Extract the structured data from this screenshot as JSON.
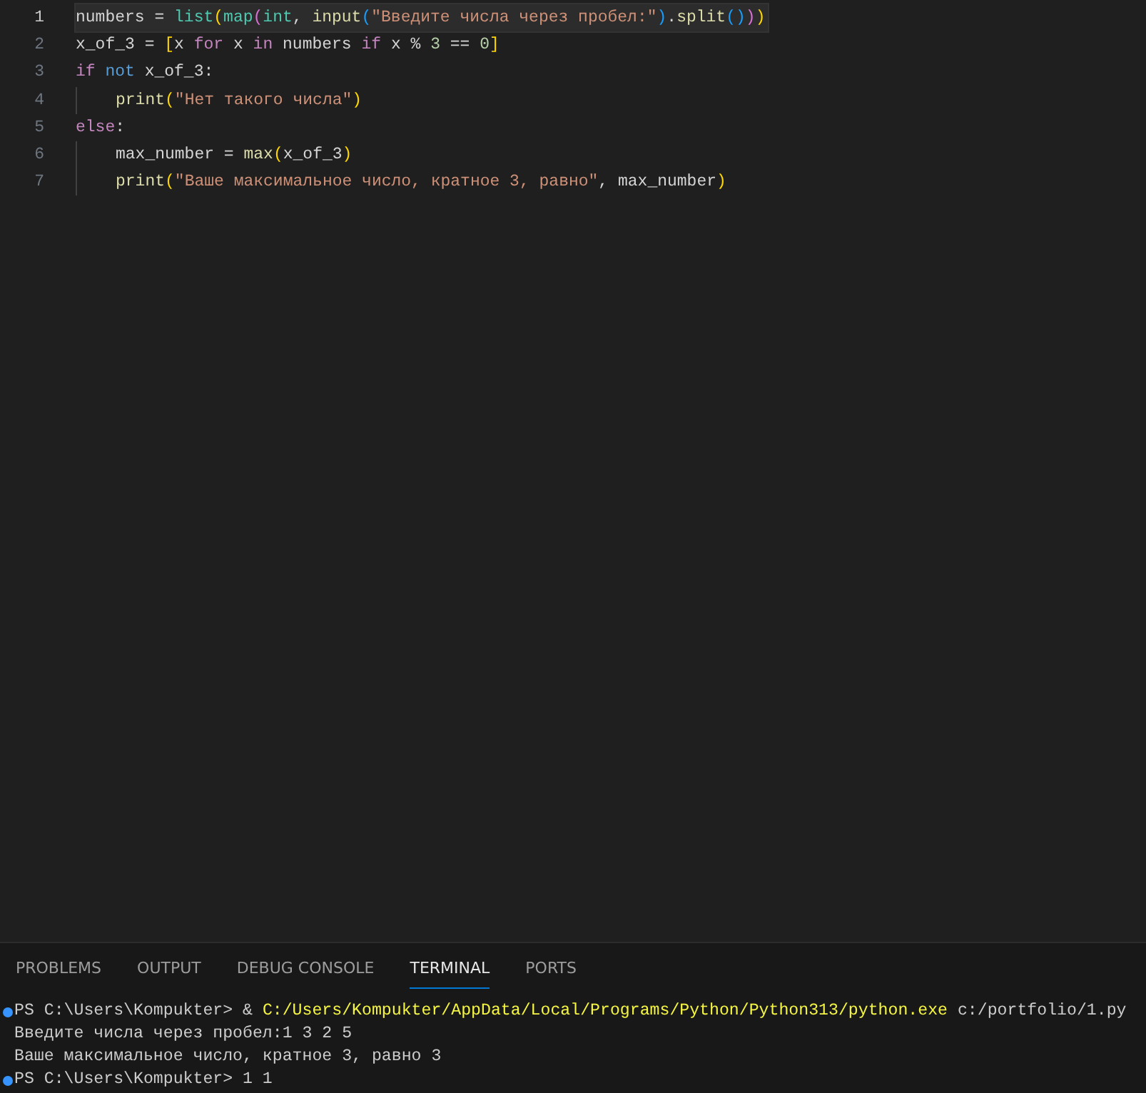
{
  "editor": {
    "lines": [
      {
        "number": "1",
        "current": true,
        "indented": false,
        "tokens": [
          {
            "kind": "var",
            "text": "numbers"
          },
          {
            "kind": "op",
            "text": " = "
          },
          {
            "kind": "cls",
            "text": "list"
          },
          {
            "kind": "b1",
            "text": "("
          },
          {
            "kind": "cls",
            "text": "map"
          },
          {
            "kind": "b2",
            "text": "("
          },
          {
            "kind": "cls",
            "text": "int"
          },
          {
            "kind": "op",
            "text": ", "
          },
          {
            "kind": "fn",
            "text": "input"
          },
          {
            "kind": "b3",
            "text": "("
          },
          {
            "kind": "str",
            "text": "\"Введите числа через пробел:\""
          },
          {
            "kind": "b3",
            "text": ")"
          },
          {
            "kind": "op",
            "text": "."
          },
          {
            "kind": "fn",
            "text": "split"
          },
          {
            "kind": "b3",
            "text": "()"
          },
          {
            "kind": "b2",
            "text": ")"
          },
          {
            "kind": "b1",
            "text": ")"
          }
        ]
      },
      {
        "number": "2",
        "current": false,
        "indented": false,
        "tokens": [
          {
            "kind": "var",
            "text": "x_of_3"
          },
          {
            "kind": "op",
            "text": " = "
          },
          {
            "kind": "b1",
            "text": "["
          },
          {
            "kind": "var",
            "text": "x "
          },
          {
            "kind": "kw",
            "text": "for"
          },
          {
            "kind": "var",
            "text": " x "
          },
          {
            "kind": "kw",
            "text": "in"
          },
          {
            "kind": "var",
            "text": " numbers "
          },
          {
            "kind": "kw",
            "text": "if"
          },
          {
            "kind": "var",
            "text": " x "
          },
          {
            "kind": "op",
            "text": "% "
          },
          {
            "kind": "num",
            "text": "3"
          },
          {
            "kind": "op",
            "text": " == "
          },
          {
            "kind": "num",
            "text": "0"
          },
          {
            "kind": "b1",
            "text": "]"
          }
        ]
      },
      {
        "number": "3",
        "current": false,
        "indented": false,
        "tokens": [
          {
            "kind": "kw",
            "text": "if"
          },
          {
            "kind": "kw2",
            "text": " not"
          },
          {
            "kind": "var",
            "text": " x_of_3"
          },
          {
            "kind": "op",
            "text": ":"
          }
        ]
      },
      {
        "number": "4",
        "current": false,
        "indented": true,
        "tokens": [
          {
            "kind": "fn",
            "text": "print"
          },
          {
            "kind": "b1",
            "text": "("
          },
          {
            "kind": "str",
            "text": "\"Нет такого числа\""
          },
          {
            "kind": "b1",
            "text": ")"
          }
        ]
      },
      {
        "number": "5",
        "current": false,
        "indented": false,
        "tokens": [
          {
            "kind": "kw",
            "text": "else"
          },
          {
            "kind": "op",
            "text": ":"
          }
        ]
      },
      {
        "number": "6",
        "current": false,
        "indented": true,
        "tokens": [
          {
            "kind": "var",
            "text": "max_number"
          },
          {
            "kind": "op",
            "text": " = "
          },
          {
            "kind": "fn",
            "text": "max"
          },
          {
            "kind": "b1",
            "text": "("
          },
          {
            "kind": "var",
            "text": "x_of_3"
          },
          {
            "kind": "b1",
            "text": ")"
          }
        ]
      },
      {
        "number": "7",
        "current": false,
        "indented": true,
        "tokens": [
          {
            "kind": "fn",
            "text": "print"
          },
          {
            "kind": "b1",
            "text": "("
          },
          {
            "kind": "str",
            "text": "\"Ваше максимальное число, кратное 3, равно\""
          },
          {
            "kind": "op",
            "text": ", "
          },
          {
            "kind": "var",
            "text": "max_number"
          },
          {
            "kind": "b1",
            "text": ")"
          }
        ]
      }
    ]
  },
  "panel": {
    "tabs": [
      {
        "label": "PROBLEMS",
        "selected": false
      },
      {
        "label": "OUTPUT",
        "selected": false
      },
      {
        "label": "DEBUG CONSOLE",
        "selected": false
      },
      {
        "label": "TERMINAL",
        "selected": true
      },
      {
        "label": "PORTS",
        "selected": false
      }
    ],
    "terminal": [
      {
        "decorated": true,
        "segments": [
          {
            "kind": "plain",
            "text": "PS C:\\Users\\Kompukter> & "
          },
          {
            "kind": "path",
            "text": "C:/Users/Kompukter/AppData/Local/Programs/Python/Python313/python.exe"
          },
          {
            "kind": "plain",
            "text": " c:/portfolio/1.py"
          }
        ]
      },
      {
        "decorated": false,
        "segments": [
          {
            "kind": "plain",
            "text": "Введите числа через пробел:1 3 2 5"
          }
        ]
      },
      {
        "decorated": false,
        "segments": [
          {
            "kind": "plain",
            "text": "Ваше максимальное число, кратное 3, равно 3"
          }
        ]
      },
      {
        "decorated": true,
        "segments": [
          {
            "kind": "plain",
            "text": "PS C:\\Users\\Kompukter> 1 1"
          }
        ]
      }
    ]
  }
}
